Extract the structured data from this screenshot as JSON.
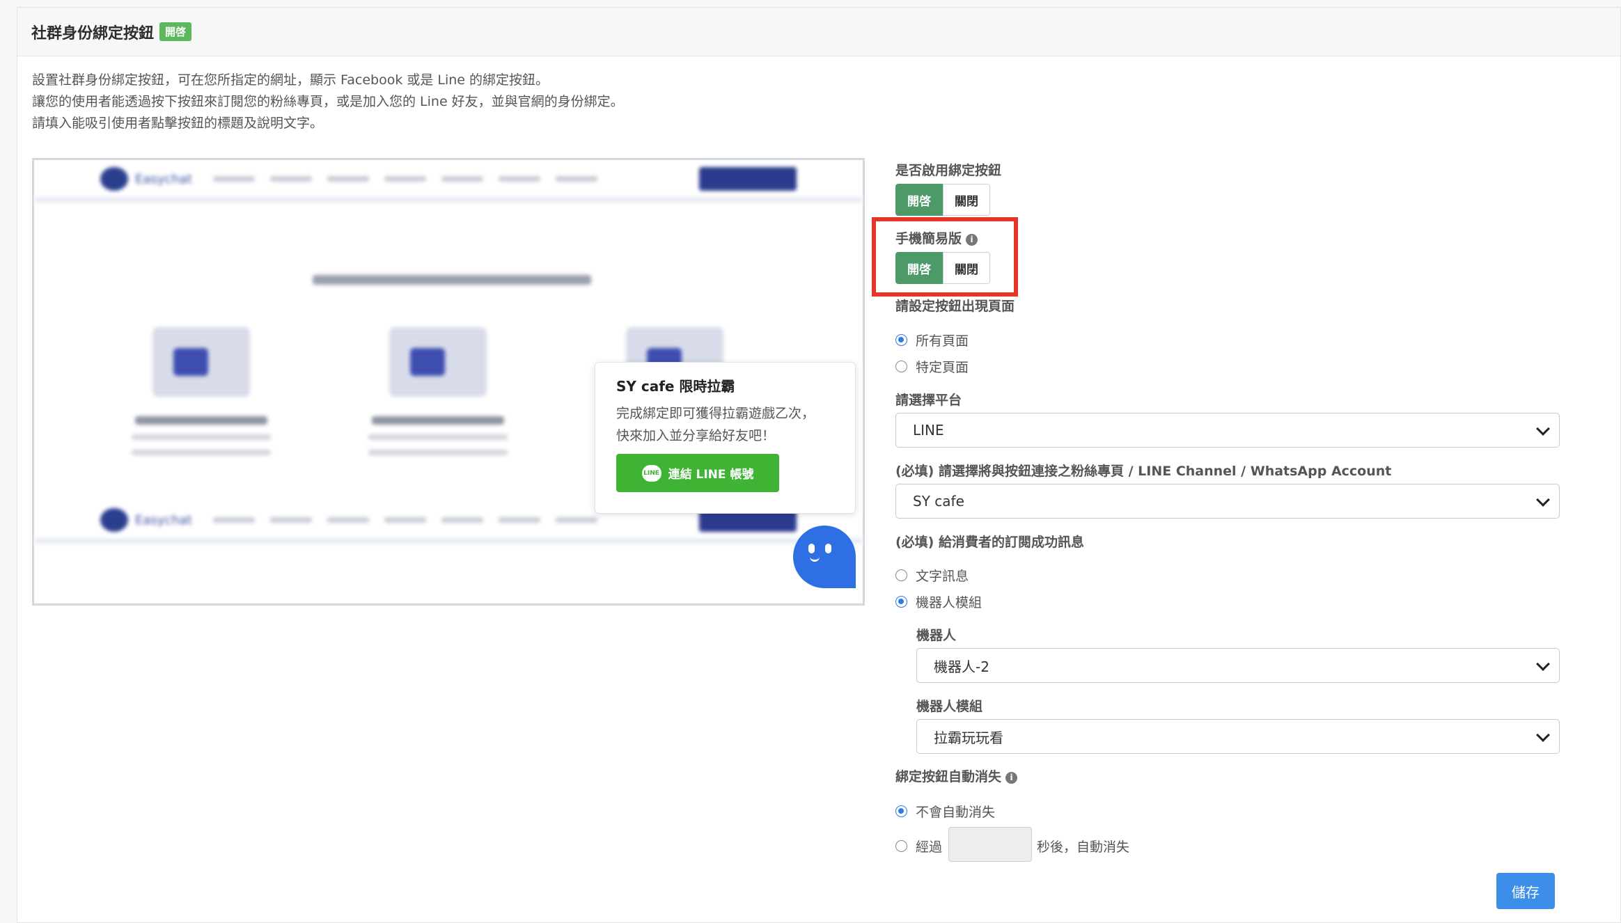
{
  "panel": {
    "title": "社群身份綁定按鈕",
    "status_badge": "開啓"
  },
  "description": [
    "設置社群身份綁定按鈕，可在您所指定的網址，顯示 Facebook 或是 Line 的綁定按鈕。",
    "讓您的使用者能透過按下按鈕來訂閱您的粉絲專頁，或是加入您的 Line 好友，並與官網的身份綁定。",
    "請填入能吸引使用者點擊按鈕的標題及說明文字。"
  ],
  "preview": {
    "site_logo_text": "Easychat",
    "popup_title": "SY cafe 限時拉霸",
    "popup_body_line1": "完成綁定即可獲得拉霸遊戲乙次，",
    "popup_body_line2": "快來加入並分享給好友吧！",
    "line_button_label": "連結 LINE 帳號",
    "line_logo_text": "LINE"
  },
  "settings": {
    "enable": {
      "label": "是否啟用綁定按鈕",
      "on": "開啓",
      "off": "關閉",
      "value": "on"
    },
    "mobile": {
      "label": "手機簡易版",
      "on": "開啓",
      "off": "關閉",
      "value": "on"
    },
    "pages": {
      "label": "請設定按鈕出現頁面",
      "all": "所有頁面",
      "specific": "特定頁面",
      "selected": "all"
    },
    "platform": {
      "label": "請選擇平台",
      "value": "LINE"
    },
    "channel": {
      "label": "(必填) 請選擇將與按鈕連接之粉絲專頁 / LINE Channel / WhatsApp Account",
      "value": "SY cafe"
    },
    "success_msg": {
      "label": "(必填) 給消費者的訂閱成功訊息",
      "text": "文字訊息",
      "bot_module": "機器人模組",
      "selected": "bot_module"
    },
    "bot": {
      "label": "機器人",
      "value": "機器人-2"
    },
    "bot_module": {
      "label": "機器人模組",
      "value": "拉霸玩玩看"
    },
    "auto_hide": {
      "label": "綁定按鈕自動消失",
      "never": "不會自動消失",
      "after_prefix": "經過",
      "after_suffix": "秒後，自動消失",
      "selected": "never",
      "seconds": ""
    },
    "save_label": "儲存"
  },
  "colors": {
    "toggle_on": "#4c9a68",
    "highlight_box": "#e6362a",
    "save_button": "#3d8ee8",
    "line_green": "#3fb334",
    "radio_checked": "#2d7be5"
  }
}
